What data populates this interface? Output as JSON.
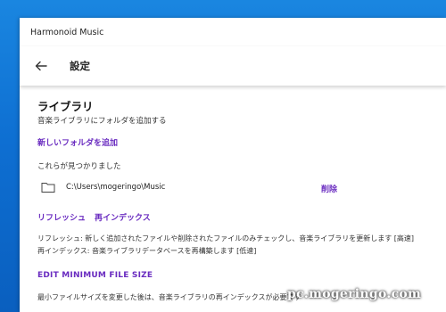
{
  "window": {
    "app_title": "Harmonoid Music"
  },
  "header": {
    "back_icon": "arrow-left-icon",
    "title": "設定"
  },
  "library": {
    "title": "ライブラリ",
    "subtitle": "音楽ライブラリにフォルダを追加する",
    "add_folder_label": "新しいフォルダを追加",
    "found_text": "これらが見つかりました",
    "folders": [
      {
        "path": "C:\\Users\\mogeringo\\Music",
        "delete_label": "削除"
      }
    ],
    "refresh_label": "リフレッシュ",
    "reindex_label": "再インデックス",
    "refresh_description": "リフレッシュ: 新しく追加されたファイルや削除されたファイルのみチェックし、音楽ライブラリを更新します [高速]",
    "reindex_description": "再インデックス: 音楽ライブラリデータベースを再構築します [低速]",
    "edit_min_file_size_label": "EDIT MINIMUM FILE SIZE",
    "min_file_size_description": "最小ファイルサイズを変更した後は、音楽ライブラリの再インデックスが必要です"
  },
  "watermark": "pc.mogeringo.com",
  "colors": {
    "accent": "#6a2cc0",
    "desktop": "#0e6fd2"
  }
}
